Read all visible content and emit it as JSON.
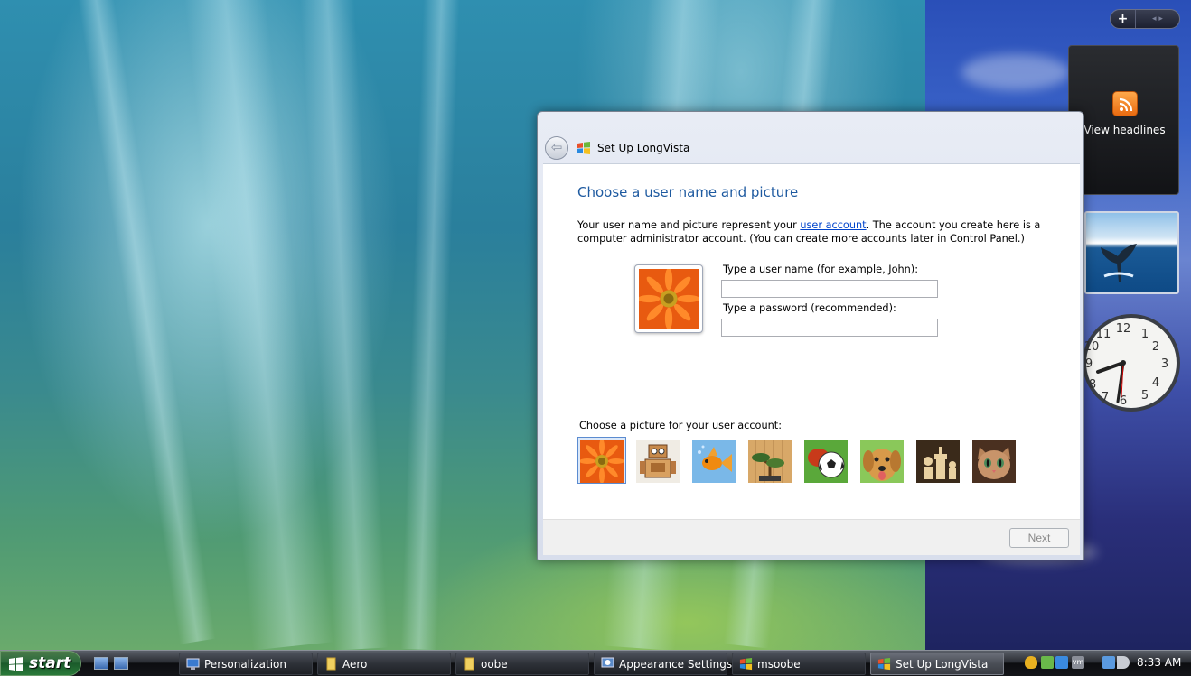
{
  "gadgets": {
    "feed_label": "View headlines",
    "clock_numbers": [
      "12",
      "1",
      "2",
      "3",
      "4",
      "5",
      "6",
      "7",
      "8",
      "9",
      "10",
      "11"
    ]
  },
  "dialog": {
    "title": "Set Up LongVista",
    "heading": "Choose a user name and picture",
    "intro_before_link": "Your user name and picture represent your ",
    "intro_link": "user account",
    "intro_after_link": ". The account you create here is a computer administrator account. (You can create more accounts later in Control Panel.)",
    "username_label": "Type a user name (for example, John):",
    "username_value": "",
    "password_label": "Type a password (recommended):",
    "password_value": "",
    "choose_picture_label": "Choose a picture for your user account:",
    "pictures": [
      "flower",
      "robot",
      "goldfish",
      "bonsai",
      "soccer-ball",
      "dog",
      "chess",
      "kitten"
    ],
    "selected_picture": "flower",
    "next_label": "Next"
  },
  "taskbar": {
    "start_label": "start",
    "buttons": [
      {
        "label": "Personalization",
        "icon": "personalization-icon"
      },
      {
        "label": "Aero",
        "icon": "folder-icon"
      },
      {
        "label": "oobe",
        "icon": "folder-icon"
      },
      {
        "label": "Appearance Settings",
        "icon": "appearance-icon"
      },
      {
        "label": "msoobe",
        "icon": "windows-icon"
      },
      {
        "label": "Set Up LongVista",
        "icon": "windows-icon",
        "active": true
      }
    ],
    "clock": "8:33 AM"
  },
  "colors": {
    "heading": "#1e5aa0",
    "link": "#0044cc"
  }
}
